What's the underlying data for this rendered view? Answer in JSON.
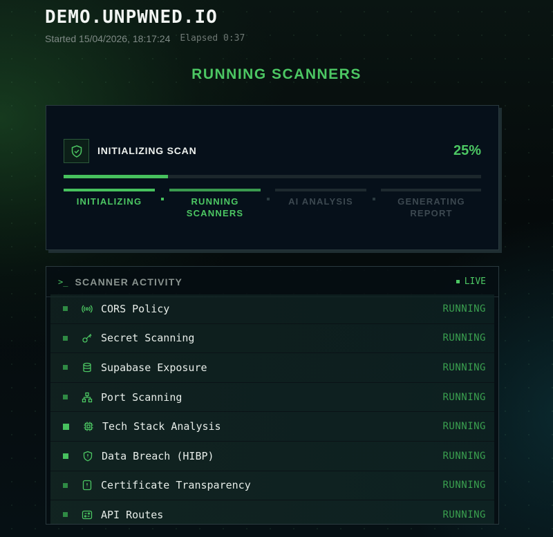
{
  "header": {
    "title": "DEMO.UNPWNED.IO",
    "started": "Started 15/04/2026, 18:17:24",
    "elapsed": "Elapsed 0:37"
  },
  "phase_title": "RUNNING SCANNERS",
  "progress": {
    "status_label": "INITIALIZING SCAN",
    "percent_text": "25%",
    "percent_value": 0.25,
    "steps": [
      {
        "label": "INITIALIZING",
        "state": "done"
      },
      {
        "label": "RUNNING SCANNERS",
        "state": "active"
      },
      {
        "label": "AI ANALYSIS",
        "state": "pending"
      },
      {
        "label": "GENERATING REPORT",
        "state": "pending"
      }
    ]
  },
  "activity": {
    "title": "SCANNER ACTIVITY",
    "live_label": "LIVE",
    "rows": [
      {
        "name": "CORS Policy",
        "status": "RUNNING",
        "icon": "broadcast-icon"
      },
      {
        "name": "Secret Scanning",
        "status": "RUNNING",
        "icon": "key-icon"
      },
      {
        "name": "Supabase Exposure",
        "status": "RUNNING",
        "icon": "database-icon"
      },
      {
        "name": "Port Scanning",
        "status": "RUNNING",
        "icon": "network-icon"
      },
      {
        "name": "Tech Stack Analysis",
        "status": "RUNNING",
        "icon": "chip-icon"
      },
      {
        "name": "Data Breach (HIBP)",
        "status": "RUNNING",
        "icon": "shield-icon"
      },
      {
        "name": "Certificate Transparency",
        "status": "RUNNING",
        "icon": "certificate-icon"
      },
      {
        "name": "API Routes",
        "status": "RUNNING",
        "icon": "api-icon"
      }
    ]
  },
  "colors": {
    "accent": "#4cc763",
    "background": "#050a0b",
    "card": "#06101a"
  }
}
